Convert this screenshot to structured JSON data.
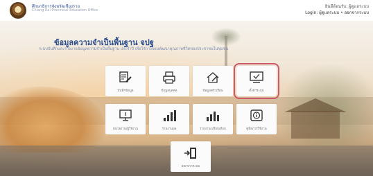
{
  "header": {
    "org_name": "ศึกษาธิการจังหวัดเชียงราย",
    "org_sub": "Chiang Rai Provincial Education Office",
    "user_line1": "ยินดีต้อนรับ: ผู้ดูแลระบบ",
    "user_line2": "Login: ผู้ดูแลระบบ • ออกจากระบบ"
  },
  "hero": {
    "title": "ข้อมูลความจำเป็นพื้นฐาน จปฐ",
    "subtitle": "ระบบบันทึกและรายงานข้อมูลความจำเป็นพื้นฐาน ประจำปี เพื่อใช้วางแผนพัฒนาคุณภาพชีวิตของประชาชนในชุมชน"
  },
  "tiles": [
    {
      "label": "บันทึกข้อมูล",
      "icon": "edit-document-icon"
    },
    {
      "label": "ข้อมูลบุคคล",
      "icon": "printer-icon"
    },
    {
      "label": "ข้อมูลครัวเรือน",
      "icon": "house-edit-icon"
    },
    {
      "label": "ตั้งค่าระบบ",
      "icon": "monitor-check-icon"
    },
    {
      "label": "หน่วยงาน/ผู้ใช้งาน",
      "icon": "monitor-icon"
    },
    {
      "label": "รายงานผล",
      "icon": "bar-chart-icon"
    },
    {
      "label": "รายงานเปรียบเทียบ",
      "icon": "bar-chart-compare-icon"
    },
    {
      "label": "คู่มือการใช้งาน",
      "icon": "info-icon"
    },
    {
      "label": "ออกจากระบบ",
      "icon": "logout-door-icon"
    }
  ],
  "colors": {
    "selected_outline": "#cc5a6a",
    "title": "#2a4d8f",
    "icon_dark": "#333333"
  }
}
